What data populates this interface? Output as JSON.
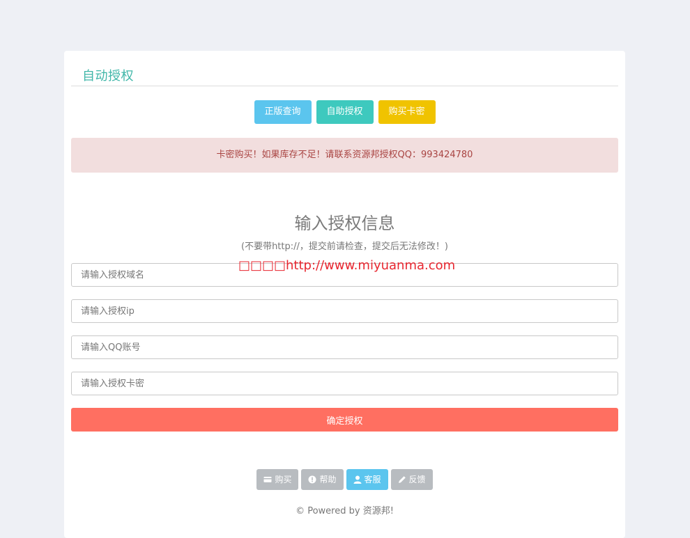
{
  "panel": {
    "title": "自动授权"
  },
  "top_buttons": {
    "genuine_query": "正版查询",
    "self_auth": "自助授权",
    "buy_card": "购买卡密"
  },
  "alert": {
    "text": "卡密购买！如果库存不足！请联系资源邦授权QQ：993424780"
  },
  "form": {
    "heading": "输入授权信息",
    "subheading": "(不要带http://，提交前请检查，提交后无法修改！)",
    "domain_placeholder": "请输入授权域名",
    "ip_placeholder": "请输入授权ip",
    "qq_placeholder": "请输入QQ账号",
    "card_placeholder": "请输入授权卡密",
    "submit_label": "确定授权"
  },
  "watermark": {
    "text": "□□□□http://www.miyuanma.com"
  },
  "footer": {
    "buy_label": "购买",
    "help_label": "帮助",
    "service_label": "客服",
    "feedback_label": "反馈",
    "copyright": "© Powered by 资源邦!"
  },
  "colors": {
    "accent_title": "#3fb6a8",
    "btn_info": "#5bc5ee",
    "btn_teal": "#3ec9be",
    "btn_yellow": "#f0c300",
    "alert_bg": "#f2dede",
    "alert_text": "#a94442",
    "submit": "#ff6f61",
    "footer_gray": "#b8bcc0"
  },
  "icons": {
    "buy": "credit-card-icon",
    "help": "exclamation-circle-icon",
    "service": "user-icon",
    "feedback": "pencil-icon"
  }
}
